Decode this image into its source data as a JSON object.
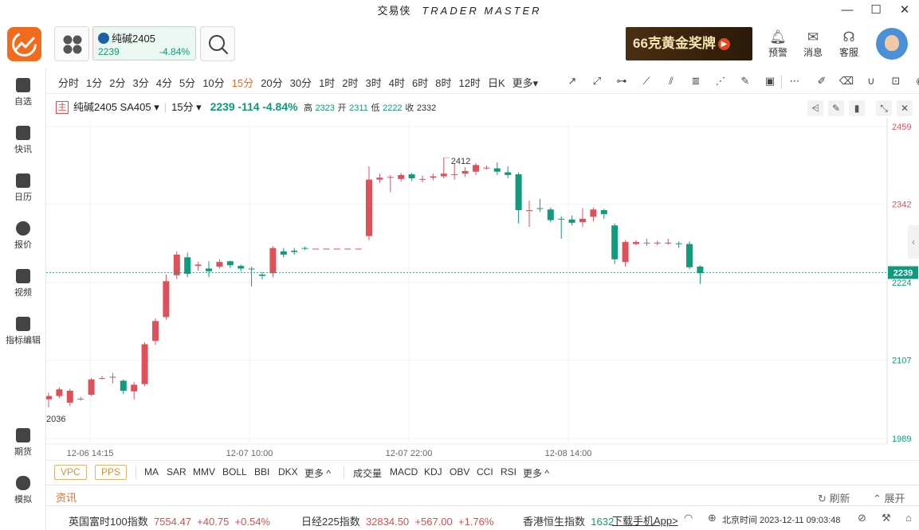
{
  "window": {
    "title_cn": "交易侠",
    "title_en": "TRADER MASTER",
    "min": "—",
    "max": "☐",
    "close": "✕"
  },
  "header": {
    "quote": {
      "name": "纯碱2405",
      "price": "2239",
      "change_pct": "-4.84%"
    },
    "ad_text": "66克黄金奖牌",
    "alerts": "预警",
    "messages": "消息",
    "service": "客服"
  },
  "sidebar": [
    "自选",
    "快讯",
    "日历",
    "报价",
    "视频",
    "指标编辑",
    "期货",
    "模拟"
  ],
  "periods": [
    "分时",
    "1分",
    "2分",
    "3分",
    "4分",
    "5分",
    "10分",
    "15分",
    "20分",
    "30分",
    "1时",
    "2时",
    "3时",
    "4时",
    "6时",
    "8时",
    "12时",
    "日K",
    "更多▾"
  ],
  "active_period": "15分",
  "info": {
    "tag": "主",
    "symbol": "纯碱2405",
    "code": "SA405 ▾",
    "period": "15分 ▾",
    "price": "2239",
    "change": "-114",
    "change_pct": "-4.84%",
    "high_label": "高",
    "high": "2323",
    "open_label": "开",
    "open": "2311",
    "low_label": "低",
    "low": "2222",
    "close_label": "收",
    "close": "2332"
  },
  "colors": {
    "up": "#e0505a",
    "down": "#0f9b7c",
    "accent": "#f06a1a"
  },
  "chart_data": {
    "type": "candlestick",
    "y_axis_ticks": [
      "2459",
      "2342",
      "2224",
      "2107",
      "1989"
    ],
    "x_axis_ticks": [
      "12-06 14:15",
      "12-07 10:00",
      "12-07 22:00",
      "12-08 14:00"
    ],
    "ylim": [
      1989,
      2459
    ],
    "current_price": "2239",
    "max_label": "2412",
    "min_label": "2036",
    "candles": [
      [
        2048,
        2053,
        2058,
        2036
      ],
      [
        2053,
        2063,
        2066,
        2050
      ],
      [
        2043,
        2061,
        2064,
        2038
      ],
      [
        2049,
        2049,
        2052,
        2046
      ],
      [
        2055,
        2078,
        2080,
        2053
      ],
      [
        2080,
        2080,
        2083,
        2078
      ],
      [
        2081,
        2082,
        2088,
        2072
      ],
      [
        2076,
        2061,
        2078,
        2056
      ],
      [
        2060,
        2070,
        2074,
        2048
      ],
      [
        2071,
        2131,
        2134,
        2068
      ],
      [
        2136,
        2166,
        2170,
        2130
      ],
      [
        2172,
        2226,
        2236,
        2168
      ],
      [
        2235,
        2266,
        2271,
        2229
      ],
      [
        2262,
        2237,
        2269,
        2232
      ],
      [
        2249,
        2251,
        2255,
        2242
      ],
      [
        2245,
        2241,
        2256,
        2232
      ],
      [
        2248,
        2255,
        2259,
        2245
      ],
      [
        2256,
        2250,
        2257,
        2246
      ],
      [
        2249,
        2245,
        2251,
        2241
      ],
      [
        2245,
        2244,
        2248,
        2218
      ],
      [
        2236,
        2234,
        2240,
        2229
      ],
      [
        2238,
        2276,
        2279,
        2232
      ],
      [
        2271,
        2266,
        2276,
        2262
      ],
      [
        2272,
        2270,
        2276,
        2266
      ],
      [
        2276,
        2275,
        2278,
        2273
      ],
      [
        2275,
        2275,
        2275,
        2275
      ],
      [
        2275,
        2275,
        2275,
        2275
      ],
      [
        2275,
        2275,
        2275,
        2275
      ],
      [
        2275,
        2275,
        2275,
        2275
      ],
      [
        2275,
        2275,
        2275,
        2275
      ],
      [
        2294,
        2379,
        2399,
        2288
      ],
      [
        2379,
        2382,
        2388,
        2374
      ],
      [
        2382,
        2383,
        2386,
        2360
      ],
      [
        2380,
        2386,
        2389,
        2376
      ],
      [
        2387,
        2381,
        2389,
        2377
      ],
      [
        2380,
        2380,
        2385,
        2375
      ],
      [
        2382,
        2384,
        2388,
        2378
      ],
      [
        2384,
        2388,
        2412,
        2381
      ],
      [
        2386,
        2387,
        2403,
        2379
      ],
      [
        2388,
        2392,
        2398,
        2383
      ],
      [
        2391,
        2401,
        2404,
        2386
      ],
      [
        2396,
        2397,
        2400,
        2394
      ],
      [
        2396,
        2391,
        2405,
        2386
      ],
      [
        2390,
        2386,
        2399,
        2381
      ],
      [
        2387,
        2333,
        2390,
        2313
      ],
      [
        2333,
        2333,
        2347,
        2308
      ],
      [
        2336,
        2335,
        2350,
        2330
      ],
      [
        2334,
        2318,
        2337,
        2315
      ],
      [
        2320,
        2319,
        2324,
        2290
      ],
      [
        2319,
        2314,
        2325,
        2310
      ],
      [
        2315,
        2320,
        2336,
        2308
      ],
      [
        2323,
        2334,
        2337,
        2316
      ],
      [
        2333,
        2327,
        2335,
        2320
      ],
      [
        2310,
        2259,
        2313,
        2252
      ],
      [
        2255,
        2285,
        2288,
        2248
      ],
      [
        2282,
        2285,
        2288,
        2280
      ],
      [
        2283,
        2284,
        2290,
        2279
      ],
      [
        2283,
        2284,
        2287,
        2280
      ],
      [
        2283,
        2284,
        2290,
        2281
      ],
      [
        2283,
        2282,
        2286,
        2276
      ],
      [
        2282,
        2247,
        2286,
        2244
      ],
      [
        2248,
        2238,
        2250,
        2222
      ]
    ]
  },
  "indicators": {
    "boxed": [
      "VPC",
      "PPS"
    ],
    "main": [
      "MA",
      "SAR",
      "MMV",
      "BOLL",
      "BBI",
      "DKX",
      "更多 ^"
    ],
    "sub": [
      "成交量",
      "MACD",
      "KDJ",
      "OBV",
      "CCI",
      "RSI",
      "更多 ^"
    ]
  },
  "news": {
    "title": "资讯",
    "refresh": "刷新",
    "expand": "展开"
  },
  "ticker": [
    {
      "name": "英国富时100指数",
      "price": "7554.47",
      "chg": "+40.75",
      "pct": "+0.54%"
    },
    {
      "name": "日经225指数",
      "price": "32834.50",
      "chg": "+567.00",
      "pct": "+1.76%"
    },
    {
      "name": "香港恒生指数",
      "price": "1632"
    }
  ],
  "download_app": "下载手机App>",
  "clock": "北京时间 2023-12-11 09:03:48"
}
